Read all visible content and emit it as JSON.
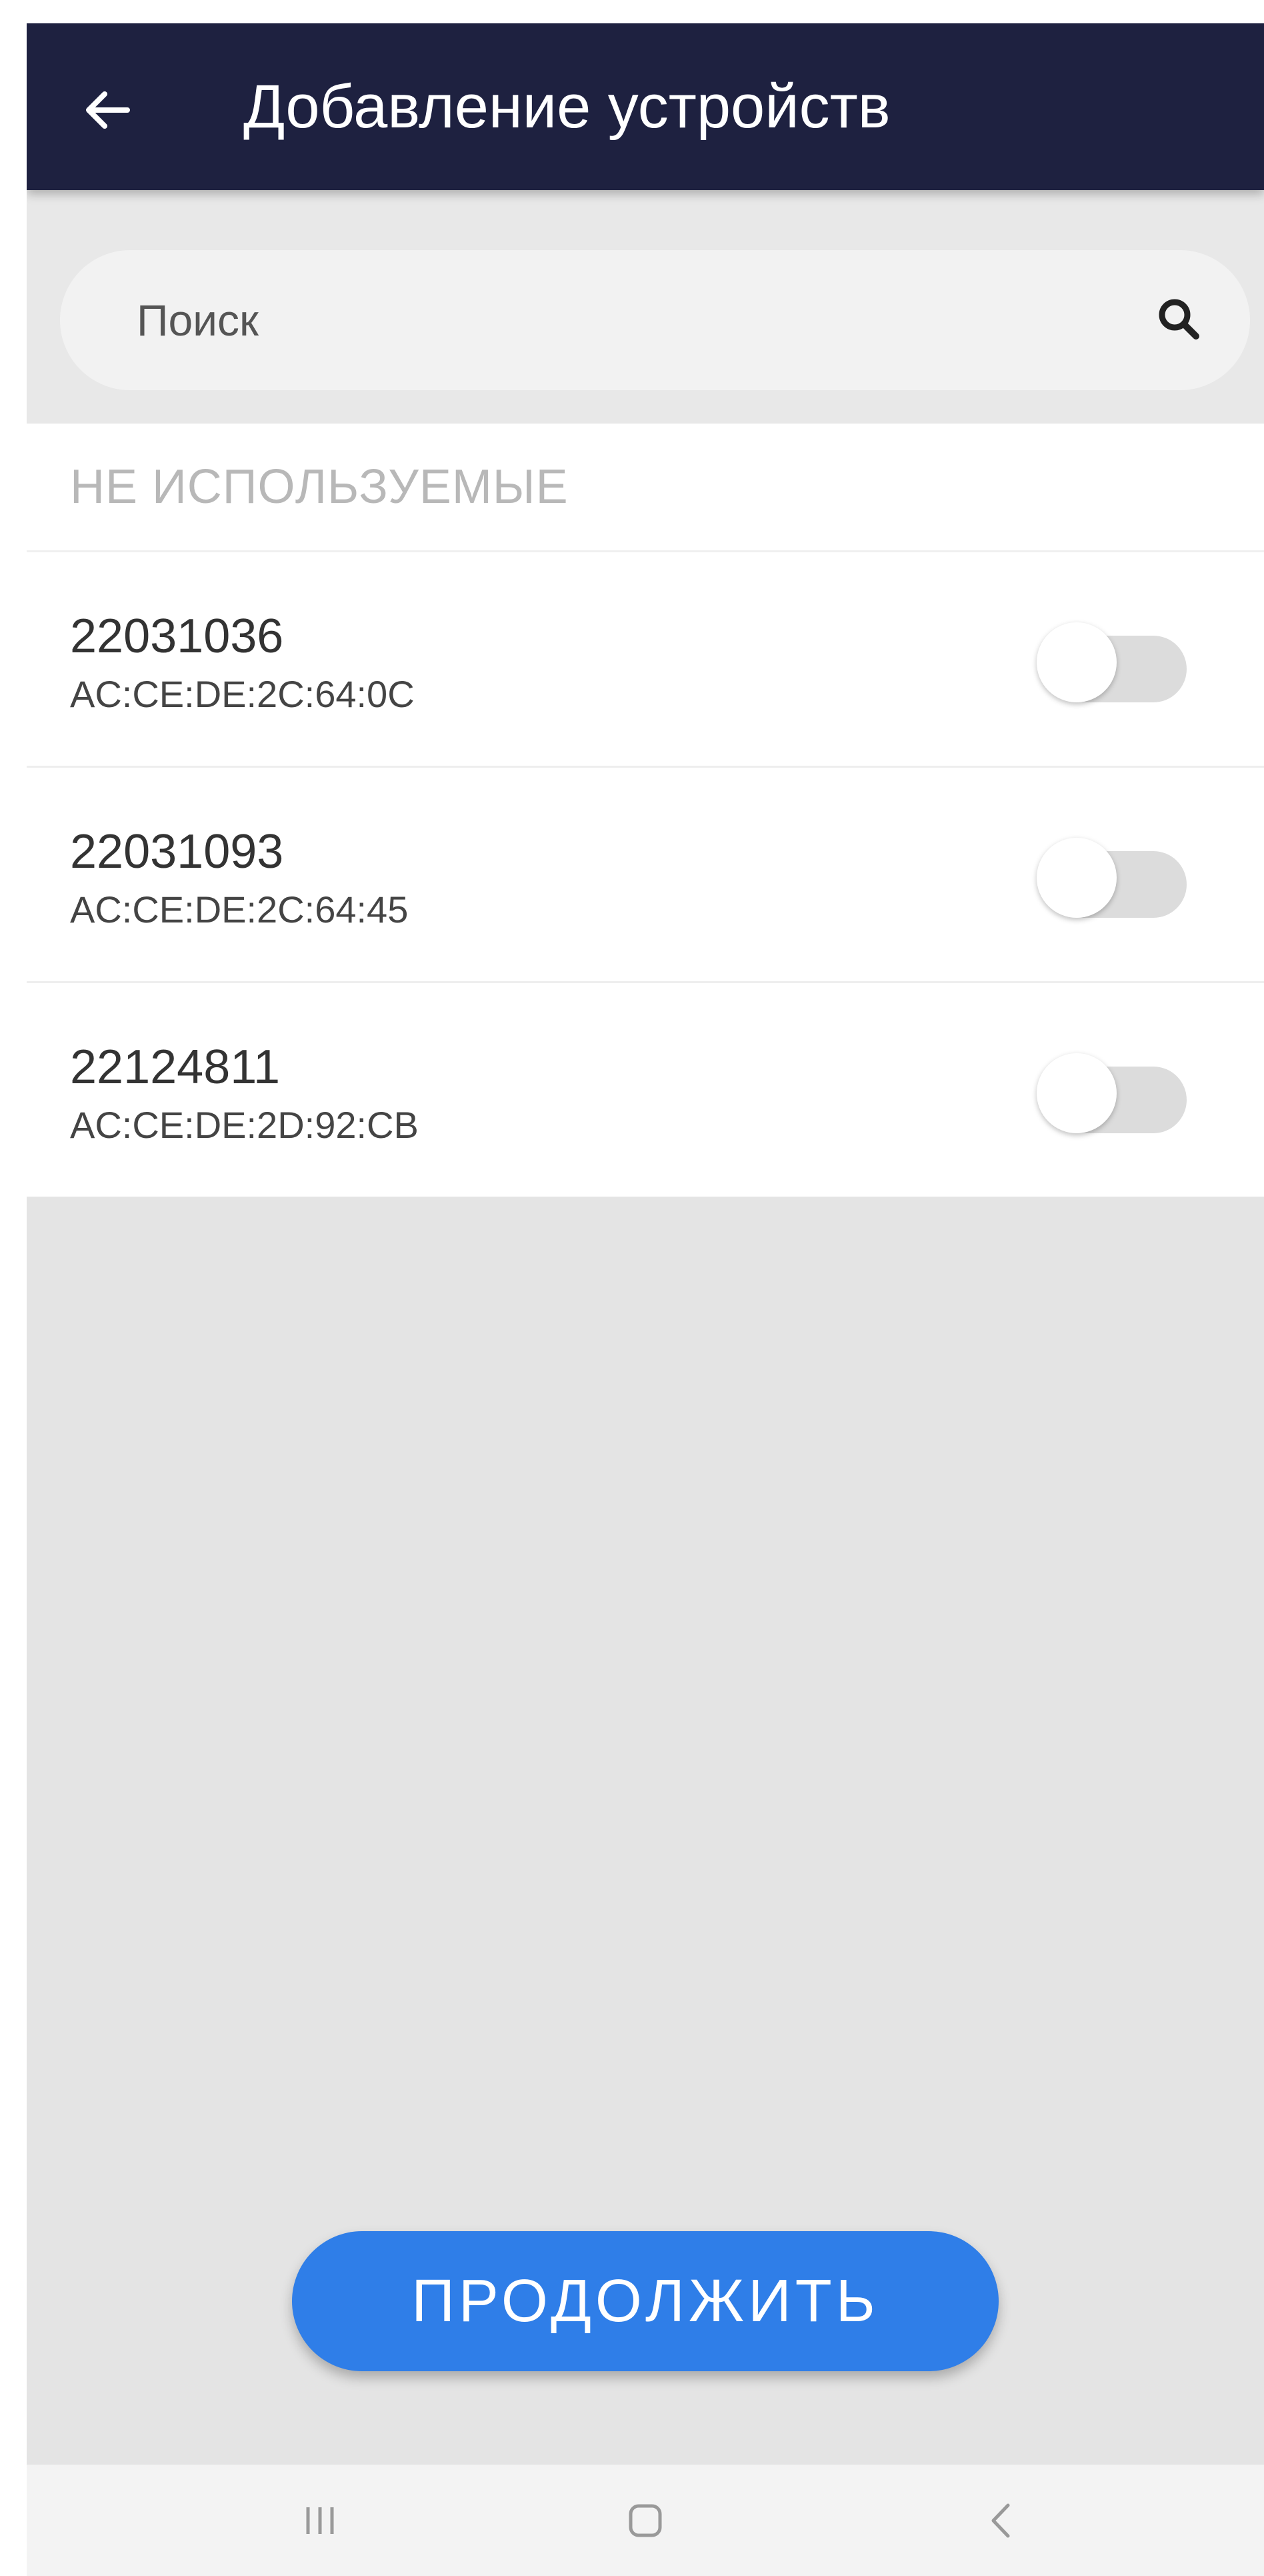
{
  "appbar": {
    "title": "Добавление устройств",
    "back_icon": "arrow-left-icon"
  },
  "search": {
    "placeholder": "Поиск",
    "value": "",
    "icon": "search-icon"
  },
  "section": {
    "header": "НЕ ИСПОЛЬЗУЕМЫЕ"
  },
  "devices": [
    {
      "name": "22031036",
      "mac": "AC:CE:DE:2C:64:0C",
      "enabled": false
    },
    {
      "name": "22031093",
      "mac": "AC:CE:DE:2C:64:45",
      "enabled": false
    },
    {
      "name": "22124811",
      "mac": "AC:CE:DE:2D:92:CB",
      "enabled": false
    }
  ],
  "continue_button": {
    "label": "ПРОДОЛЖИТЬ"
  },
  "navbar": {
    "recents_icon": "recents-icon",
    "home_icon": "home-icon",
    "back_icon": "nav-back-icon"
  },
  "colors": {
    "appbar": "#1e2140",
    "accent": "#2f7ee8",
    "background": "#e4e4e4"
  }
}
